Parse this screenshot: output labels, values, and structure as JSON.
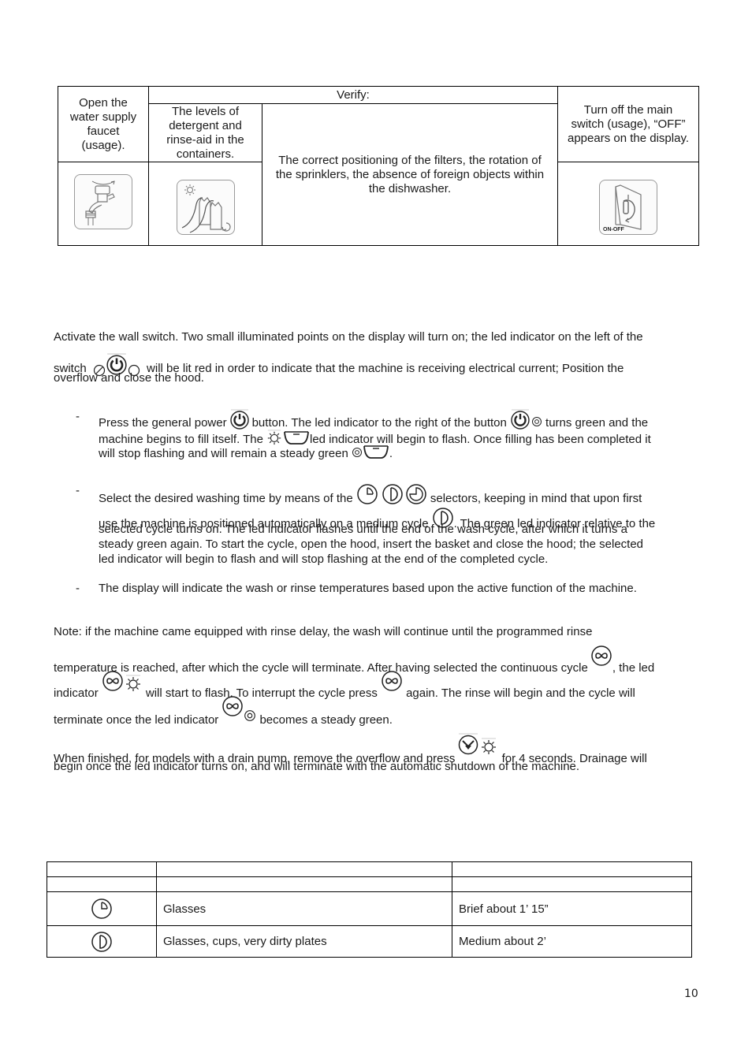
{
  "top_table": {
    "verify_header": "Verify:",
    "col1_text": "Open the water supply faucet (usage).",
    "col2_text": "The levels of detergent and rinse-aid in the containers.",
    "col3_text": "The correct positioning of the filters, the rotation of the sprinklers, the absence of foreign objects within the dishwasher.",
    "col4_text": "Turn off the main switch (usage), “OFF” appears on the display.",
    "icons": [
      "water-faucet-icon",
      "detergent-containers-icon",
      "on-off-switch-icon"
    ],
    "switch_label": "ON-OFF"
  },
  "intro": {
    "line1": "Activate the wall switch. Two small illuminated points on the display will turn on; the led indicator on the left of the",
    "line2_a": "switch",
    "line2_b": "will be lit red in order to indicate that the machine is receiving electrical current; Position the",
    "line3": "overflow and close the hood."
  },
  "bullets": [
    {
      "dash": "-",
      "a": "Press the general power",
      "b": "button. The led indicator to the right of the button",
      "c": "turns green and the",
      "d": "machine begins to fill itself. The",
      "e": "led indicator will begin to flash. Once filling has been completed it",
      "f": "will stop flashing and will remain a steady green",
      "g": "."
    },
    {
      "dash": "-",
      "a": "Select the desired washing time by means of the",
      "b": "selectors, keeping in mind that upon first",
      "c": "use the machine is positioned automatically on a medium cycle",
      "d": ". The green led indicator relative to the",
      "e": "selected cycle turns on. The led indicator flashes until the end of the wash cycle, after which it turns a",
      "f": "steady green again. To start the cycle, open the hood, insert the basket and close the hood; the selected",
      "g": "led indicator will begin to flash and will stop flashing at the end of the completed cycle."
    },
    {
      "dash": "-",
      "a": "The display will indicate the wash or rinse temperatures based upon the active function of the machine."
    }
  ],
  "note": {
    "l1": "Note: if the machine came equipped with rinse delay, the wash will continue until the programmed rinse",
    "l2a": "temperature is reached, after which the cycle will terminate. After having selected the continuous cycle",
    "l2b": ", the led",
    "l3a": "indicator",
    "l3b": "will start to flash. To interrupt the cycle press",
    "l3c": "again. The rinse will begin and the cycle will",
    "l4a": "terminate once the led indicator",
    "l4b": "becomes a steady green."
  },
  "finish": {
    "l1a": "When finished, for models with a drain pump, remove the overflow and press",
    "l1b": "for 4 seconds. Drainage will",
    "l2": "begin once the led indicator turns on, and will terminate with the automatic shutdown of the machine."
  },
  "cycle_table": {
    "header_row": [
      "",
      "",
      ""
    ],
    "blank_row": [
      "",
      "",
      ""
    ],
    "rows": [
      {
        "icon": "brief-cycle-icon",
        "items": "Glasses",
        "duration": "Brief about 1’ 15”"
      },
      {
        "icon": "medium-cycle-icon",
        "items": "Glasses, cups, very dirty plates",
        "duration": "Medium about 2’"
      }
    ]
  },
  "page_number": "10"
}
